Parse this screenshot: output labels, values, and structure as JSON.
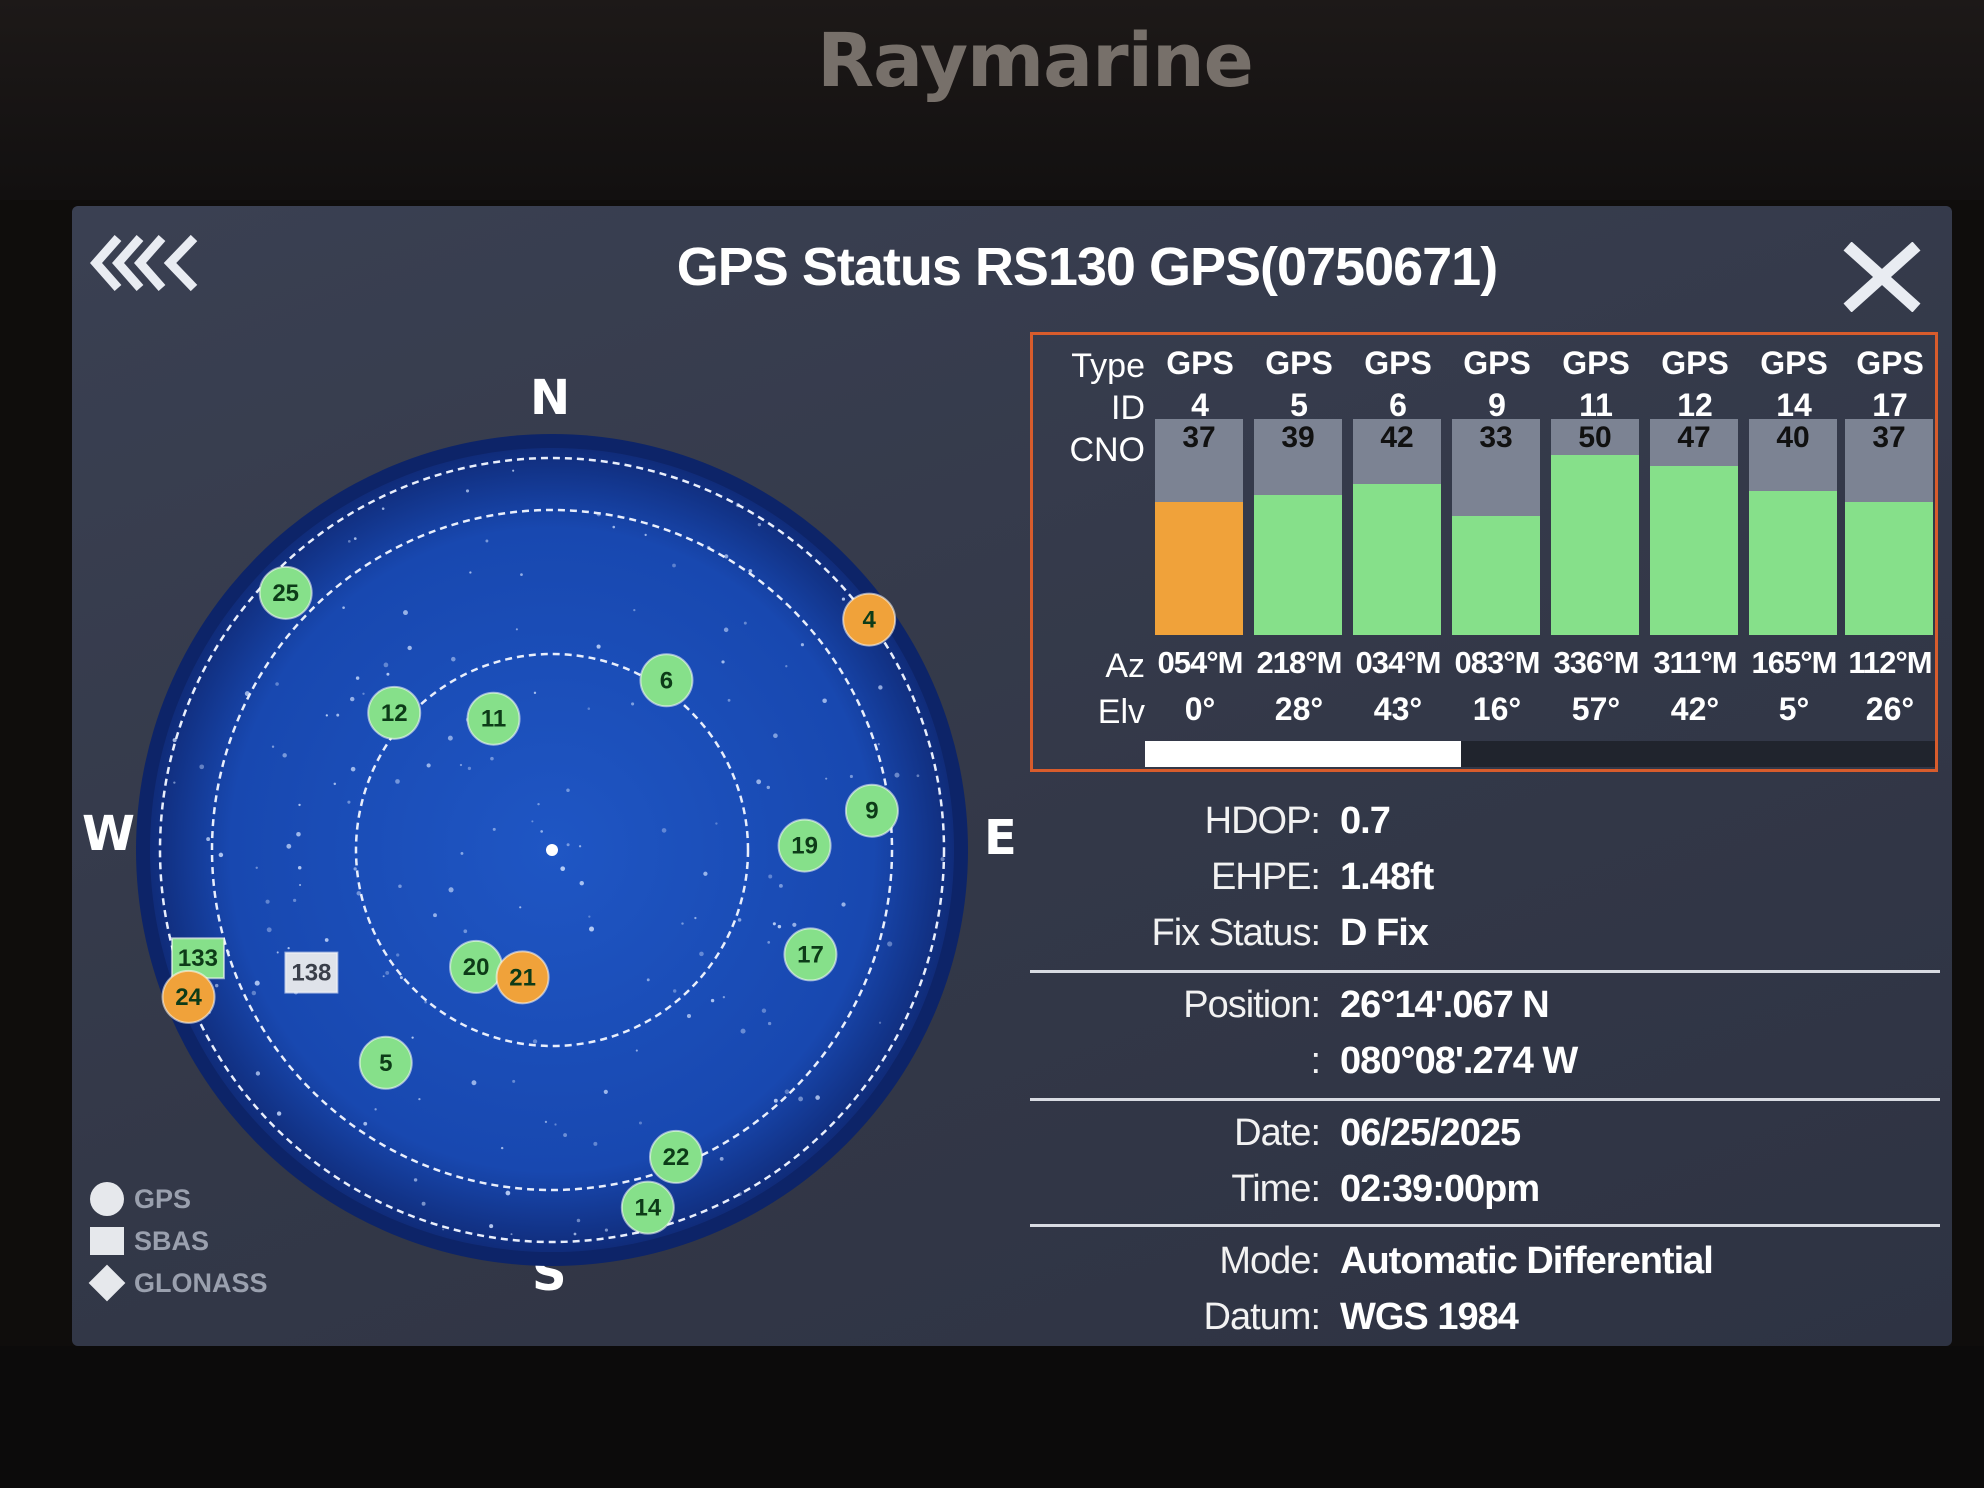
{
  "device": {
    "brand": "Raymarine"
  },
  "header": {
    "title": "GPS Status RS130 GPS(0750671)",
    "back_icon": "back-chevrons-icon",
    "close_icon": "close-icon"
  },
  "skyplot": {
    "directions": {
      "n": "N",
      "s": "S",
      "e": "E",
      "w": "W"
    },
    "colors": {
      "sky": "#1848b0",
      "good": "#86e08a",
      "weak": "#f0a23a",
      "sbas_untracked": "#dfe3ea"
    },
    "satellites": [
      {
        "id": "25",
        "shape": "circle",
        "status": "good",
        "az": 314,
        "elv": 5
      },
      {
        "id": "6",
        "shape": "circle",
        "status": "good",
        "az": 34,
        "elv": 43
      },
      {
        "id": "4",
        "shape": "circle",
        "status": "weak",
        "az": 54,
        "elv": 0
      },
      {
        "id": "11",
        "shape": "circle",
        "status": "good",
        "az": 336,
        "elv": 57
      },
      {
        "id": "12",
        "shape": "circle",
        "status": "good",
        "az": 311,
        "elv": 42
      },
      {
        "id": "9",
        "shape": "circle",
        "status": "good",
        "az": 83,
        "elv": 16
      },
      {
        "id": "19",
        "shape": "circle",
        "status": "good",
        "az": 89,
        "elv": 32
      },
      {
        "id": "17",
        "shape": "circle",
        "status": "good",
        "az": 112,
        "elv": 26
      },
      {
        "id": "133",
        "shape": "square",
        "status": "good",
        "az": 253,
        "elv": 5
      },
      {
        "id": "24",
        "shape": "circle",
        "status": "weak",
        "az": 248,
        "elv": 0
      },
      {
        "id": "138",
        "shape": "square",
        "status": "sbas_untracked",
        "az": 243,
        "elv": 28
      },
      {
        "id": "20",
        "shape": "circle",
        "status": "good",
        "az": 213,
        "elv": 58
      },
      {
        "id": "21",
        "shape": "circle",
        "status": "weak",
        "az": 193,
        "elv": 60
      },
      {
        "id": "5",
        "shape": "circle",
        "status": "good",
        "az": 218,
        "elv": 28
      },
      {
        "id": "22",
        "shape": "circle",
        "status": "good",
        "az": 158,
        "elv": 14
      },
      {
        "id": "14",
        "shape": "circle",
        "status": "good",
        "az": 165,
        "elv": 5
      }
    ]
  },
  "legend": [
    {
      "label": "GPS",
      "icon": "circle-icon"
    },
    {
      "label": "SBAS",
      "icon": "square-icon"
    },
    {
      "label": "GLONASS",
      "icon": "diamond-icon"
    }
  ],
  "satellite_table": {
    "labels": {
      "type": "Type",
      "id": "ID",
      "cno": "CNO",
      "az": "Az",
      "elv": "Elv"
    },
    "cno_max": 60,
    "columns": [
      {
        "type": "GPS",
        "id": "4",
        "cno": "37",
        "az": "054°M",
        "elv": "0°",
        "status": "weak"
      },
      {
        "type": "GPS",
        "id": "5",
        "cno": "39",
        "az": "218°M",
        "elv": "28°",
        "status": "good"
      },
      {
        "type": "GPS",
        "id": "6",
        "cno": "42",
        "az": "034°M",
        "elv": "43°",
        "status": "good"
      },
      {
        "type": "GPS",
        "id": "9",
        "cno": "33",
        "az": "083°M",
        "elv": "16°",
        "status": "good"
      },
      {
        "type": "GPS",
        "id": "11",
        "cno": "50",
        "az": "336°M",
        "elv": "57°",
        "status": "good"
      },
      {
        "type": "GPS",
        "id": "12",
        "cno": "47",
        "az": "311°M",
        "elv": "42°",
        "status": "good"
      },
      {
        "type": "GPS",
        "id": "14",
        "cno": "40",
        "az": "165°M",
        "elv": "5°",
        "status": "good"
      },
      {
        "type": "GPS",
        "id": "17",
        "cno": "37",
        "az": "112°M",
        "elv": "26°",
        "status": "good"
      }
    ],
    "scroll_fraction": 0.4
  },
  "info": {
    "hdop_label": "HDOP:",
    "hdop": "0.7",
    "ehpe_label": "EHPE:",
    "ehpe": "1.48ft",
    "fix_label": "Fix Status:",
    "fix": "D Fix",
    "position_label": "Position:",
    "lat": "26°14'.067 N",
    "lon_label": ":",
    "lon": "080°08'.274 W",
    "date_label": "Date:",
    "date": "06/25/2025",
    "time_label": "Time:",
    "time": "02:39:00pm",
    "mode_label": "Mode:",
    "mode": "Automatic Differential",
    "datum_label": "Datum:",
    "datum": "WGS 1984"
  }
}
